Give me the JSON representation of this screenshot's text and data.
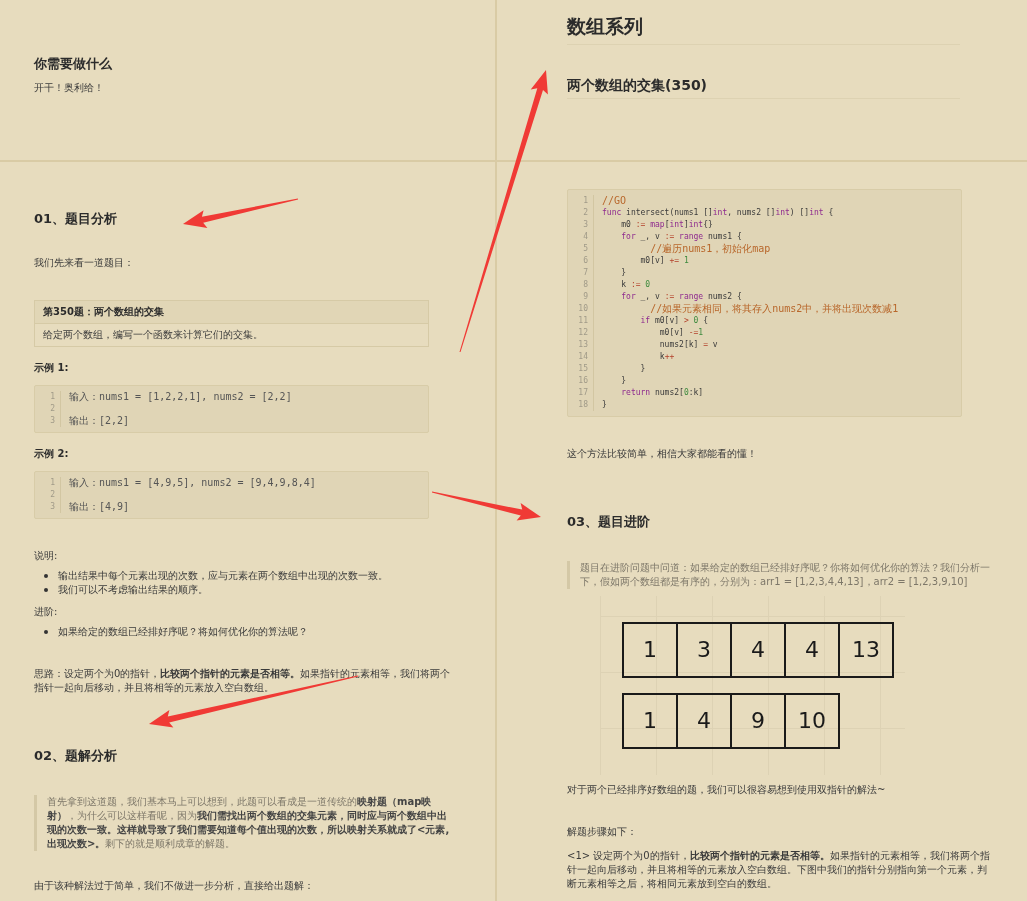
{
  "top_left": {
    "blocks": [
      {
        "kind": "heading",
        "text": "你需要做什么"
      },
      {
        "kind": "paragraph",
        "text": "开干！奥利给！"
      }
    ]
  },
  "top_right": {
    "blocks": [
      {
        "kind": "page_title",
        "text": "数组系列"
      },
      {
        "kind": "section_title",
        "text": "两个数组的交集(350)"
      }
    ]
  },
  "bottom_left": {
    "blocks": [
      {
        "kind": "heading",
        "text": "01、题目分析"
      },
      {
        "kind": "paragraph",
        "text": "我们先来看一道题目："
      },
      {
        "kind": "problem",
        "title": "第350题：两个数组的交集",
        "body": "给定两个数组，编写一个函数来计算它们的交集。"
      },
      {
        "kind": "subheading",
        "text": "示例 1:"
      },
      {
        "kind": "code",
        "lines": [
          {
            "number": "1",
            "tokens": [
              {
                "kind": "plain",
                "text": "输入：nums1 = [1,2,2,1], nums2 = [2,2]"
              }
            ]
          },
          {
            "number": "2"
          },
          {
            "number": "3",
            "tokens": [
              {
                "kind": "plain",
                "text": "输出：[2,2]"
              }
            ]
          }
        ]
      },
      {
        "kind": "subheading",
        "text": "示例 2:"
      },
      {
        "kind": "code",
        "lines": [
          {
            "number": "1",
            "tokens": [
              {
                "kind": "plain",
                "text": "输入：nums1 = [4,9,5], nums2 = [9,4,9,8,4]"
              }
            ]
          },
          {
            "number": "2"
          },
          {
            "number": "3",
            "tokens": [
              {
                "kind": "plain",
                "text": "输出：[4,9]"
              }
            ]
          }
        ]
      },
      {
        "kind": "note",
        "text": "说明:"
      },
      {
        "kind": "list",
        "items": [
          "输出结果中每个元素出现的次数，应与元素在两个数组中出现的次数一致。",
          "我们可以不考虑输出结果的顺序。"
        ]
      },
      {
        "kind": "note",
        "text": "进阶:"
      },
      {
        "kind": "list",
        "items": [
          "如果给定的数组已经排好序呢？将如何优化你的算法呢？"
        ]
      },
      {
        "kind": "paragraph",
        "text": "思路：设定两个为0的指针，**比较两个指针的元素是否相等。**如果指针的元素相等，我们将两个指针一起向后移动，并且将相等的元素放入空白数组。"
      },
      {
        "kind": "heading",
        "text": "02、题解分析"
      },
      {
        "kind": "quote",
        "text": "首先拿到这道题，我们基本马上可以想到，此题可以看成是一道传统的**映射题（map映射）**，为什么可以这样看呢，因为**我们需找出两个数组的交集元素，同时应与两个数组中出现的次数一致。这样就导致了我们需要知道每个值出现的次数，所以映射关系就成了<元素,出现次数>。**剩下的就是顺利成章的解题。"
      },
      {
        "kind": "paragraph",
        "text": "由于该种解法过于简单，我们不做进一步分析，直接给出题解："
      }
    ]
  },
  "bottom_right": {
    "blocks": [
      {
        "kind": "code",
        "lines": [
          {
            "number": "1",
            "tokens": [
              {
                "kind": "comment",
                "text": "//GO"
              }
            ]
          },
          {
            "number": "2",
            "tokens": [
              {
                "kind": "keyword",
                "text": "func"
              },
              {
                "kind": "plain",
                "text": " intersect(nums1 []"
              },
              {
                "kind": "keyword",
                "text": "int"
              },
              {
                "kind": "plain",
                "text": ", nums2 []"
              },
              {
                "kind": "keyword",
                "text": "int"
              },
              {
                "kind": "plain",
                "text": ") []"
              },
              {
                "kind": "keyword",
                "text": "int"
              },
              {
                "kind": "plain",
                "text": " {"
              }
            ]
          },
          {
            "number": "3",
            "tokens": [
              {
                "kind": "plain",
                "text": "    m0 "
              },
              {
                "kind": "operator",
                "text": ":= "
              },
              {
                "kind": "keyword",
                "text": "map"
              },
              {
                "kind": "plain",
                "text": "["
              },
              {
                "kind": "keyword",
                "text": "int"
              },
              {
                "kind": "plain",
                "text": "]"
              },
              {
                "kind": "keyword",
                "text": "int"
              },
              {
                "kind": "plain",
                "text": "{}"
              }
            ]
          },
          {
            "number": "4",
            "tokens": [
              {
                "kind": "keyword",
                "text": "    for"
              },
              {
                "kind": "plain",
                "text": " _, v "
              },
              {
                "kind": "operator",
                "text": ":= "
              },
              {
                "kind": "keyword",
                "text": "range"
              },
              {
                "kind": "plain",
                "text": " nums1 {"
              }
            ]
          },
          {
            "number": "5",
            "tokens": [
              {
                "kind": "comment",
                "text": "        //遍历nums1，初始化map"
              }
            ]
          },
          {
            "number": "6",
            "tokens": [
              {
                "kind": "plain",
                "text": "        m0[v] "
              },
              {
                "kind": "operator",
                "text": "+= "
              },
              {
                "kind": "number",
                "text": "1"
              }
            ]
          },
          {
            "number": "7",
            "tokens": [
              {
                "kind": "plain",
                "text": "    }"
              }
            ]
          },
          {
            "number": "8",
            "tokens": [
              {
                "kind": "plain",
                "text": "    k "
              },
              {
                "kind": "operator",
                "text": ":= "
              },
              {
                "kind": "number",
                "text": "0"
              }
            ]
          },
          {
            "number": "9",
            "tokens": [
              {
                "kind": "keyword",
                "text": "    for"
              },
              {
                "kind": "plain",
                "text": " _, v "
              },
              {
                "kind": "operator",
                "text": ":= "
              },
              {
                "kind": "keyword",
                "text": "range"
              },
              {
                "kind": "plain",
                "text": " nums2 {"
              }
            ]
          },
          {
            "number": "10",
            "tokens": [
              {
                "kind": "comment",
                "text": "        //如果元素相同，将其存入nums2中，并将出现次数减1"
              }
            ]
          },
          {
            "number": "11",
            "tokens": [
              {
                "kind": "keyword",
                "text": "        if"
              },
              {
                "kind": "plain",
                "text": " m0[v] "
              },
              {
                "kind": "operator",
                "text": "> "
              },
              {
                "kind": "number",
                "text": "0"
              },
              {
                "kind": "plain",
                "text": " {"
              }
            ]
          },
          {
            "number": "12",
            "tokens": [
              {
                "kind": "plain",
                "text": "            m0[v] "
              },
              {
                "kind": "operator",
                "text": "-="
              },
              {
                "kind": "number",
                "text": "1"
              }
            ]
          },
          {
            "number": "13",
            "tokens": [
              {
                "kind": "plain",
                "text": "            nums2[k] "
              },
              {
                "kind": "operator",
                "text": "= "
              },
              {
                "kind": "plain",
                "text": "v"
              }
            ]
          },
          {
            "number": "14",
            "tokens": [
              {
                "kind": "plain",
                "text": "            k"
              },
              {
                "kind": "operator",
                "text": "++"
              }
            ]
          },
          {
            "number": "15",
            "tokens": [
              {
                "kind": "plain",
                "text": "        }"
              }
            ]
          },
          {
            "number": "16",
            "tokens": [
              {
                "kind": "plain",
                "text": "    }"
              }
            ]
          },
          {
            "number": "17",
            "tokens": [
              {
                "kind": "keyword",
                "text": "    return"
              },
              {
                "kind": "plain",
                "text": " nums2["
              },
              {
                "kind": "number",
                "text": "0"
              },
              {
                "kind": "plain",
                "text": ":k]"
              }
            ]
          },
          {
            "number": "18",
            "tokens": [
              {
                "kind": "plain",
                "text": "}"
              }
            ]
          }
        ]
      },
      {
        "kind": "paragraph",
        "text": "这个方法比较简单，相信大家都能看的懂！"
      },
      {
        "kind": "heading",
        "text": "03、题目进阶"
      },
      {
        "kind": "quote",
        "text": "题目在进阶问题中问道：如果给定的数组已经排好序呢？你将如何优化你的算法？我们分析一下，假如两个数组都是有序的，分别为：arr1 = [1,2,3,4,4,13]，arr2 = [1,2,3,9,10]"
      },
      {
        "kind": "diagram",
        "rows": [
          {
            "cells": [
              "1",
              "3",
              "4",
              "4",
              "13"
            ]
          },
          {
            "cells": [
              "1",
              "4",
              "9",
              "10"
            ]
          }
        ]
      },
      {
        "kind": "paragraph",
        "text": "对于两个已经排序好数组的题，我们可以很容易想到使用双指针的解法~"
      },
      {
        "kind": "paragraph",
        "text": "解题步骤如下："
      },
      {
        "kind": "step",
        "text": "<1> 设定两个为0的指针，**比较两个指针的元素是否相等。**如果指针的元素相等，我们将两个指针一起向后移动，并且将相等的元素放入空白数组。下图中我们的指针分别指向第一个元素，判断元素相等之后，将相同元素放到空白的数组。"
      }
    ]
  }
}
